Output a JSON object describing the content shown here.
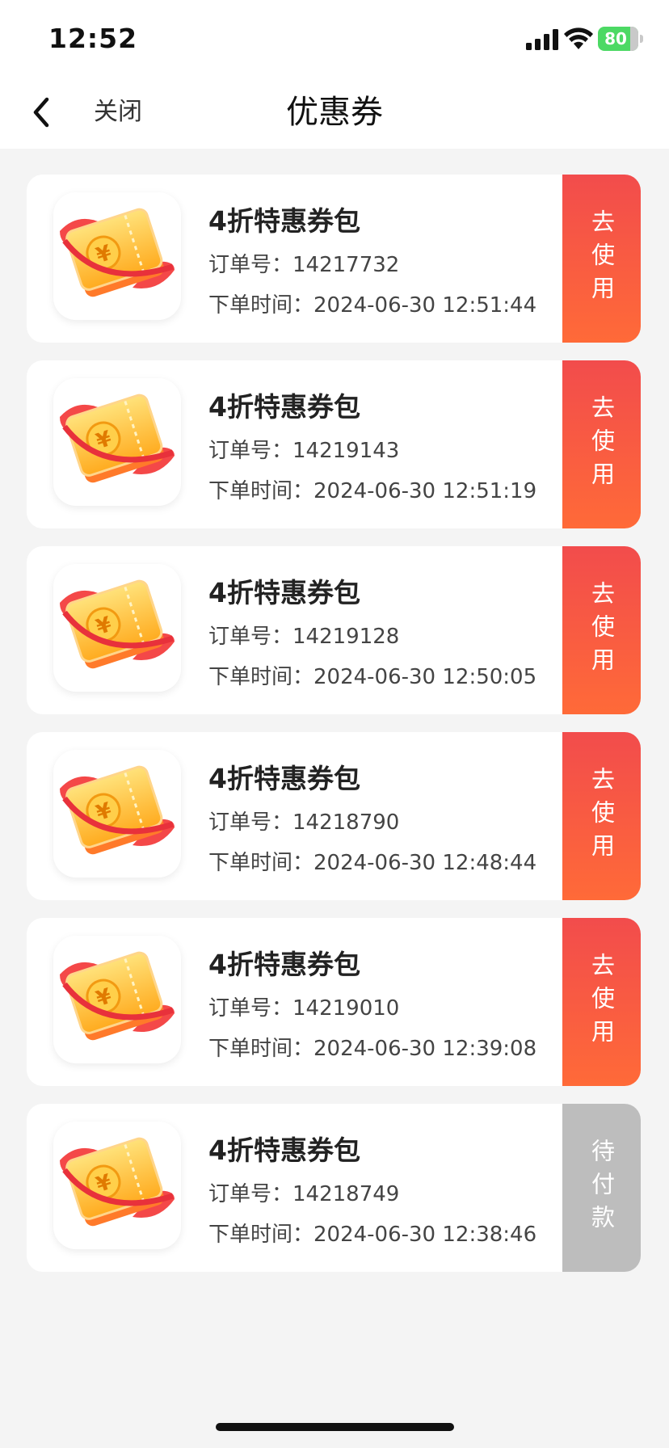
{
  "status_bar": {
    "time": "12:52",
    "battery": "80",
    "signal_icon": "cellular-signal-icon",
    "wifi_icon": "wifi-icon",
    "battery_icon": "battery-charging-icon"
  },
  "nav": {
    "back_icon": "chevron-left-icon",
    "close_label": "关闭",
    "title": "优惠券"
  },
  "coupons": [
    {
      "title": "4折特惠券包",
      "order": "订单号：14217732",
      "time": "下单时间：2024-06-30 12:51:44",
      "action": "去使用",
      "status": "active"
    },
    {
      "title": "4折特惠券包",
      "order": "订单号：14219143",
      "time": "下单时间：2024-06-30 12:51:19",
      "action": "去使用",
      "status": "active"
    },
    {
      "title": "4折特惠券包",
      "order": "订单号：14219128",
      "time": "下单时间：2024-06-30 12:50:05",
      "action": "去使用",
      "status": "active"
    },
    {
      "title": "4折特惠券包",
      "order": "订单号：14218790",
      "time": "下单时间：2024-06-30 12:48:44",
      "action": "去使用",
      "status": "active"
    },
    {
      "title": "4折特惠券包",
      "order": "订单号：14219010",
      "time": "下单时间：2024-06-30 12:39:08",
      "action": "去使用",
      "status": "active"
    },
    {
      "title": "4折特惠券包",
      "order": "订单号：14218749",
      "time": "下单时间：2024-06-30 12:38:46",
      "action": "待付款",
      "status": "pending"
    }
  ],
  "colors": {
    "action_active_top": "#f24c4c",
    "action_active_bottom": "#ff6a38",
    "action_pending": "#bdbdbd",
    "battery_green": "#4cd964"
  }
}
